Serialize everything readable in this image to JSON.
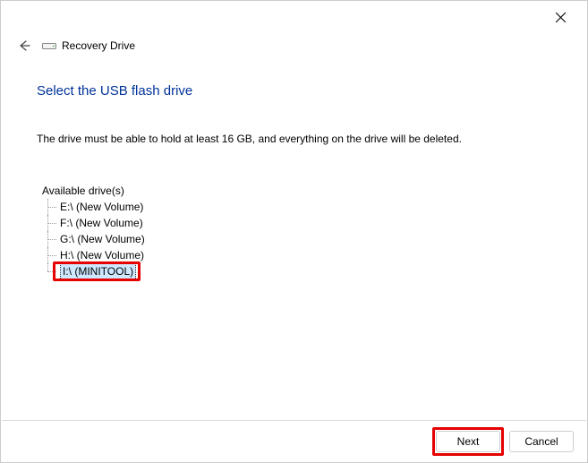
{
  "titlebar": {
    "wizard_title": "Recovery Drive"
  },
  "page": {
    "heading": "Select the USB flash drive",
    "instruction": "The drive must be able to hold at least 16 GB, and everything on the drive will be deleted.",
    "drives_label": "Available drive(s)"
  },
  "drives": [
    {
      "label": "E:\\ (New Volume)",
      "selected": false
    },
    {
      "label": "F:\\ (New Volume)",
      "selected": false
    },
    {
      "label": "G:\\ (New Volume)",
      "selected": false
    },
    {
      "label": "H:\\ (New Volume)",
      "selected": false
    },
    {
      "label": "I:\\ (MINITOOL)",
      "selected": true
    }
  ],
  "buttons": {
    "next": "Next",
    "cancel": "Cancel"
  }
}
